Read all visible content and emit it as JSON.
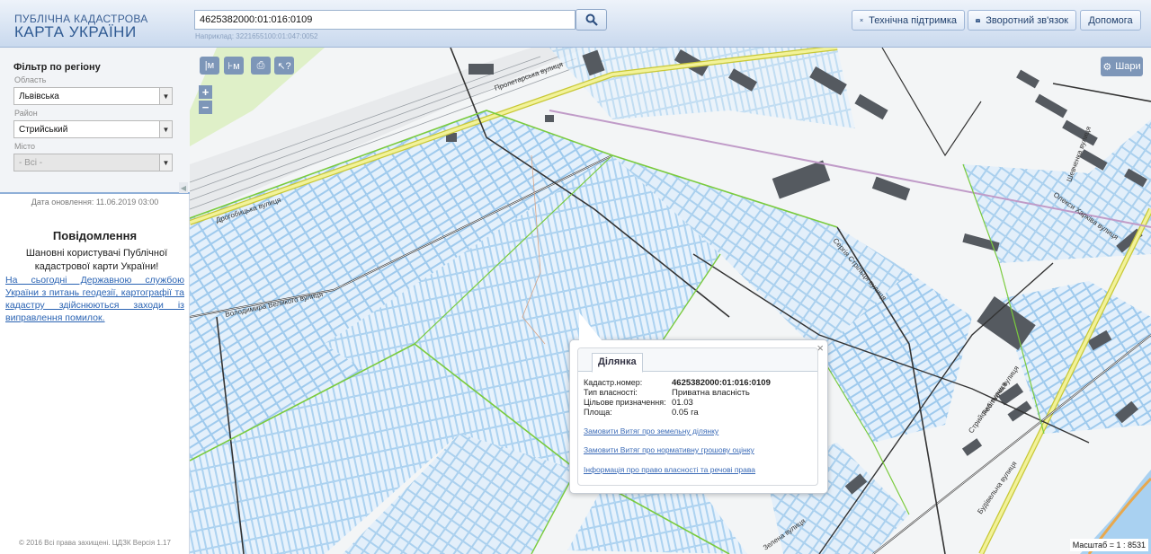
{
  "header": {
    "logo_line1": "ПУБЛІЧНА КАДАСТРОВА",
    "logo_line2": "КАРТА УКРАЇНИ",
    "search_value": "4625382000:01:016:0109",
    "search_hint": "Наприклад: 3221655100:01:047:0052",
    "buttons": {
      "support": "Технічна підтримка",
      "feedback": "Зворотний зв'язок",
      "help": "Допомога"
    }
  },
  "sidebar": {
    "filter_title": "Фільтр по регіону",
    "oblast_label": "Область",
    "oblast_value": "Львівська",
    "raion_label": "Район",
    "raion_value": "Стрийський",
    "city_label": "Місто",
    "city_value": "- Всі -",
    "updated": "Дата оновлення: 11.06.2019 03:00",
    "notice_title": "Повідомлення",
    "notice_text": "Шановні користувачі Публічної кадастрової карти України!",
    "notice_link": "На сьогодні Державною службою України з питань геодезії, картографії та кадастру здійснюються заходи із виправлення помилок.",
    "copyright": "© 2016 Всі права захищені. ЦДЗК Версія 1.17"
  },
  "map": {
    "tools": [
      "|м",
      "⊦м",
      "⎙",
      "↖?"
    ],
    "zoom_in": "+",
    "zoom_out": "−",
    "layers_label": "Шари",
    "scale_text": "Масштаб = 1 : 8531",
    "streets": [
      "Пролетарська вулиця",
      "Сергія Стрільця вулиця",
      "Дрогобицька вулиця",
      "Стрийська вулиця",
      "Робітнича вулиця",
      "Будівельна вулиця",
      "Олекси Харківа вулиця",
      "Шевченка вулиця",
      "Зелена вулиця"
    ]
  },
  "popup": {
    "tab_label": "Ділянка",
    "close": "×",
    "rows": [
      {
        "key": "Кадастр.номер:",
        "value": "4625382000:01:016:0109"
      },
      {
        "key": "Тип власності:",
        "value": "Приватна власність"
      },
      {
        "key": "Цільове призначення:",
        "value": "01.03"
      },
      {
        "key": "Площа:",
        "value": "0.05 га"
      }
    ],
    "links": [
      "Замовити Витяг про земельну ділянку",
      "Замовити Витяг про нормативну грошову оцінку",
      "Інформація про право власності та речові права"
    ]
  }
}
